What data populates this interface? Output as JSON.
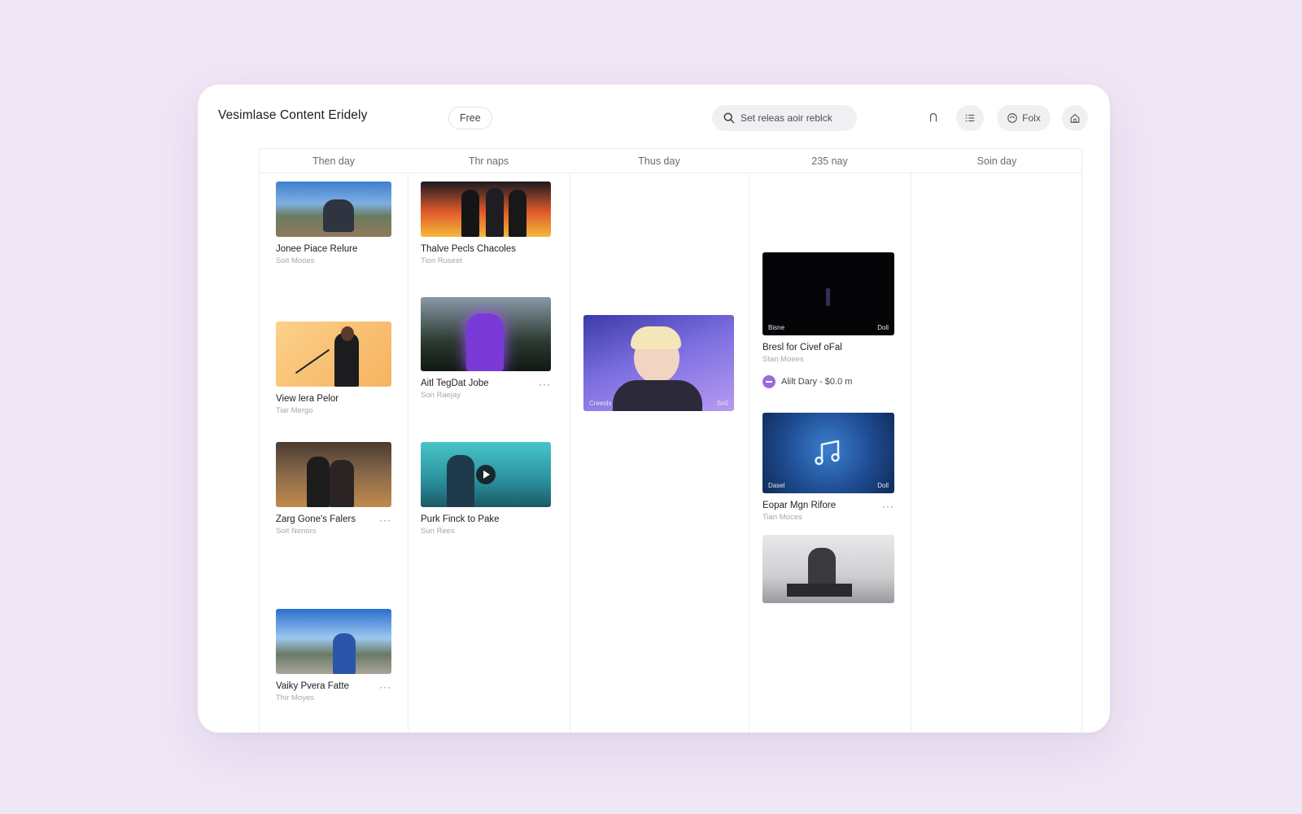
{
  "header": {
    "app_title": "Vesimlase Content Eridely",
    "plan_badge": "Free",
    "search_placeholder": "Set releas aoir reblck",
    "folx_label": "Folx"
  },
  "columns": [
    "Then day",
    "Thr naps",
    "Thus day",
    "235 nay",
    "Soin day"
  ],
  "cards": {
    "c1": {
      "title": "Jonee Piace Relure",
      "sub": "Soit Mooes"
    },
    "c2": {
      "title": "View lera Pelor",
      "sub": "Tiar Mergo"
    },
    "c3": {
      "title": "Zarg Gone's Falers",
      "sub": "Soit Nenors"
    },
    "c4": {
      "title": "Vaiky Pvera Fatte",
      "sub": "Thir Moyes"
    },
    "c5": {
      "title": "Thalve Pecls Chacoles",
      "sub": "Tion Ruseet"
    },
    "c6": {
      "title": "Aitl TegDat Jobe",
      "sub": "Son Raejay"
    },
    "c7": {
      "title": "Purk Finck to Pake",
      "sub": "Sun Rees"
    },
    "c8": {
      "corner_left": "Creeols",
      "corner_right": "Sn0"
    },
    "c9": {
      "title": "Bresl for Civef oFal",
      "sub": "Stan Moees",
      "corner_left": "Bisne",
      "corner_right": "Doll",
      "event": "Alilt Dary - $0.0 m"
    },
    "c10": {
      "title": "Eopar Mgn Rifore",
      "sub": "Tian Moces",
      "corner_left": "Dasel",
      "corner_right": "Doll"
    }
  },
  "more_label": "···"
}
